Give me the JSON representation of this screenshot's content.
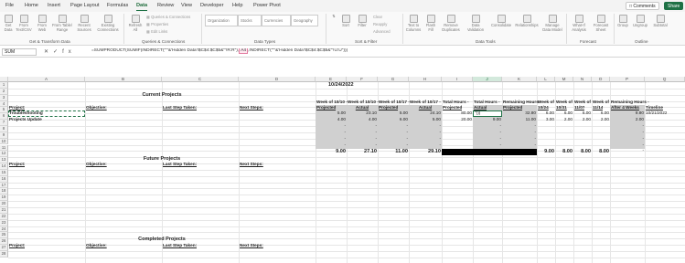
{
  "menu": [
    "File",
    "Home",
    "Insert",
    "Page Layout",
    "Formulas",
    "Data",
    "Review",
    "View",
    "Developer",
    "Help",
    "Power Pivot"
  ],
  "active_menu": "Data",
  "top_buttons": {
    "comments": "Comments",
    "share": "Share"
  },
  "ribbon": {
    "get_data": "Get Data",
    "from_text_csv": "From Text/CSV",
    "from_web": "From Web",
    "from_table_range": "From Table/ Range",
    "recent_sources": "Recent Sources",
    "existing_connections": "Existing Connections",
    "refresh_all": "Refresh All",
    "queries_connections": "Queries & Connections",
    "properties": "Properties",
    "edit_links": "Edit Links",
    "organization": "Organization",
    "stocks": "Stocks",
    "currencies": "Currencies",
    "geography": "Geography",
    "sort": "Sort",
    "filter": "Filter",
    "clear": "Clear",
    "reapply": "Reapply",
    "advanced": "Advanced",
    "text_to_columns": "Text to Columns",
    "flash_fill": "Flash Fill",
    "remove_duplicates": "Remove Duplicates",
    "data_validation": "Data Validation",
    "consolidate": "Consolidate",
    "relationships": "Relationships",
    "manage_data_model": "Manage Data Model",
    "what_if": "What-If Analysis",
    "forecast_sheet": "Forecast Sheet",
    "group": "Group",
    "ungroup": "Ungroup",
    "subtotal": "Subtotal",
    "groups": [
      "Get & Transform Data",
      "Queries & Connections",
      "Data Types",
      "Sort & Filter",
      "Data Tools",
      "Forecast",
      "Outline"
    ]
  },
  "formula_bar": {
    "name_box": "SUM",
    "fx": "fx",
    "formula_prefix": "=SUMPRODUCT(SUMIF(INDIRECT(\"'\"&'Hidden Data'!$C$4:$C$5&\"'!R:R\"),",
    "formula_highlight": "A4",
    "formula_suffix": ",INDIRECT(\"'\"&'Hidden Data'!$C$4:$C$5&\"'!U:U\")))"
  },
  "columns": [
    "A",
    "B",
    "C",
    "D",
    "E",
    "F",
    "G",
    "H",
    "I",
    "J",
    "K",
    "L",
    "M",
    "N",
    "O",
    "P",
    "Q"
  ],
  "rows": [
    "1",
    "2",
    "3",
    "4",
    "5",
    "6",
    "7",
    "8",
    "9",
    "10",
    "11",
    "12",
    "13",
    "14",
    "15",
    "16",
    "17",
    "18",
    "19",
    "20",
    "21",
    "22",
    "23",
    "24",
    "25",
    "26",
    "27",
    "28"
  ],
  "sheet": {
    "date": "10/24/2022",
    "current_projects": "Current Projects",
    "future_projects": "Future Projects",
    "completed_projects": "Completed Projects",
    "headers": {
      "project": "Project:",
      "objective": "Objective:",
      "last_step": "Last Step Taken:",
      "next_steps": "Next Steps:",
      "e_top": "Week of 10/10 -",
      "e_bot": "Projected",
      "f_top": "Week of 10/10 -",
      "f_bot": "Actual",
      "g_top": "Week of 10/17 -",
      "g_bot": "Projected",
      "h_top": "Week of 10/17 -",
      "h_bot": "Actual",
      "i_top": "Total Hours -",
      "i_bot": "Projected",
      "j_top": "Total Hours -",
      "j_bot": "Actual",
      "k_top": "Remaining Hours -",
      "k_bot": "Projected",
      "l_top": "Week of",
      "l_bot": "10/24",
      "m_top": "Week of",
      "m_bot": "10/31",
      "n_top": "Week of",
      "n_bot": "11/07",
      "o_top": "Week of",
      "o_bot": "11/14",
      "p_top": "Remaining Hours -",
      "p_bot": "After 4 Weeks",
      "q_top": "Timeline",
      "q_bot": "10/21/2022"
    },
    "row4": {
      "a": "Troubleshooting",
      "e": "5.00",
      "f": "23.10",
      "g": "5.00",
      "h": "24.10",
      "i": "80.00",
      "j": "\")))",
      "k": "32.80",
      "l": "6.00",
      "m": "6.00",
      "n": "6.00",
      "o": "6.00",
      "p": "8.80"
    },
    "row5": {
      "a": "Projects Update",
      "e": "4.00",
      "f": "4.00",
      "g": "6.00",
      "h": "5.00",
      "i": "20.00",
      "j": "9.00",
      "k": "11.00",
      "l": "3.00",
      "m": "2.00",
      "n": "2.00",
      "o": "2.00",
      "p": "2.00"
    },
    "dash": "-",
    "totals": {
      "e": "9.00",
      "f": "27.10",
      "g": "11.00",
      "h": "29.10",
      "l": "9.00",
      "m": "8.00",
      "n": "8.00",
      "o": "8.00"
    }
  }
}
